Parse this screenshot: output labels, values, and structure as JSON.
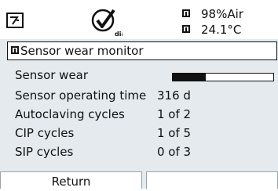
{
  "header": {
    "status_line1": "98%Air",
    "status_line2": "24.1°C",
    "diag_icon_label": "diag"
  },
  "title": "Sensor wear monitor",
  "rows": [
    {
      "label": "Sensor wear",
      "value": "",
      "wear_fraction": 0.33
    },
    {
      "label": "Sensor operating time",
      "value": "316 d"
    },
    {
      "label": "Autoclaving cycles",
      "value": "1 of 2"
    },
    {
      "label": "CIP cycles",
      "value": "1 of 5"
    },
    {
      "label": "SIP cycles",
      "value": "0 of 3"
    }
  ],
  "softkeys": {
    "left": "Return",
    "right": ""
  },
  "colors": {
    "panel_bg": "#e4eaee",
    "foreground": "#111111"
  }
}
